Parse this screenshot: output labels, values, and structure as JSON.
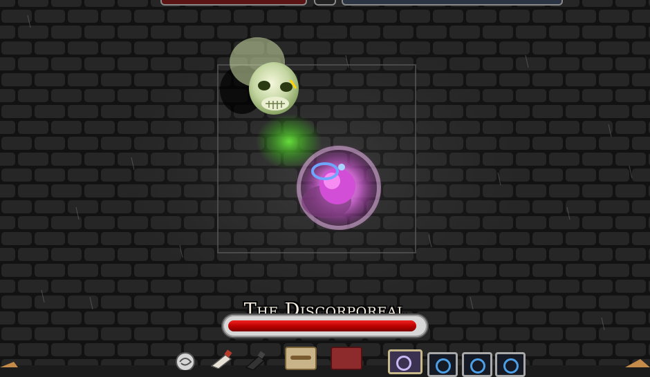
{
  "boss": {
    "name": "The Discorporeal",
    "health_fraction": 0.97
  },
  "colors": {
    "player_health": "#5a1414",
    "player_mana": "#2a3442",
    "boss_health": "#d91414",
    "player_glow": "#e26ce6",
    "ghost_glow": "#4cdc2a"
  },
  "hotbar": {
    "consumables": [
      "scroll-icon",
      "potion-icon",
      "bomb-icon"
    ],
    "items": [
      "rope-icon",
      "tome-icon"
    ],
    "skills": [
      "hook-skill-icon",
      "ring-skill-icon",
      "ring-skill-icon",
      "ring-skill-icon"
    ]
  }
}
